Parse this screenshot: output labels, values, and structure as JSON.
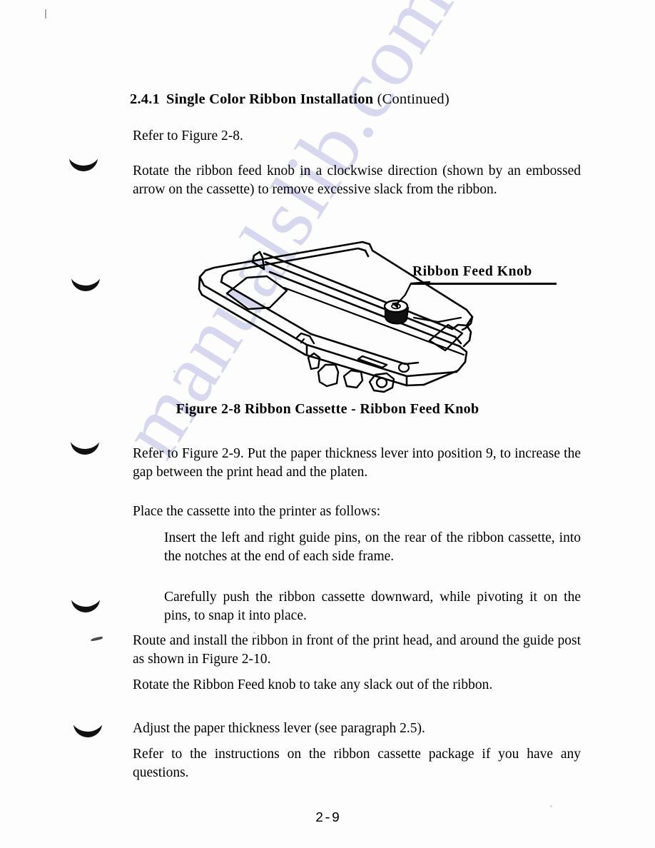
{
  "document": {
    "page_number": "2-9",
    "watermark": "manualslib.com"
  },
  "heading": {
    "number": "2.4.1",
    "title": "Single Color Ribbon Installation",
    "continued": "(Continued)"
  },
  "body": {
    "p_refer_fig_2_8": "Refer to Figure 2-8.",
    "p_rotate_knob": "Rotate the ribbon feed knob in a clockwise direction (shown by an embossed arrow on the cassette) to remove excessive slack from the ribbon.",
    "p_refer_fig_2_9": "Refer to Figure 2-9.  Put the paper thickness lever into position 9, to increase the gap between the print head and the platen.",
    "p_place_cassette": "Place the cassette into the printer as follows:",
    "p_insert_pins": "Insert the left and right guide pins, on the rear of the ribbon cassette, into the notches at the end of each side frame.",
    "p_push_down": "Carefully push the ribbon cassette downward, while pivoting it on the pins, to snap it into place.",
    "p_route_ribbon": "Route and install the ribbon in front of the print head, and around the guide post as shown in Figure 2-10.",
    "p_rotate_feed": "Rotate the Ribbon Feed knob to take any slack out of the ribbon.",
    "p_adjust_lever": "Adjust the paper thickness lever (see paragraph 2.5).",
    "p_refer_package": "Refer to the instructions on the ribbon cassette package if you have any questions."
  },
  "figure": {
    "callout_label": "Ribbon Feed Knob",
    "caption": "Figure 2-8  Ribbon Cassette - Ribbon Feed Knob",
    "subject": "ribbon-cassette-line-drawing"
  },
  "margin_marks": {
    "symbol": "crescent-mark",
    "count": 5
  }
}
